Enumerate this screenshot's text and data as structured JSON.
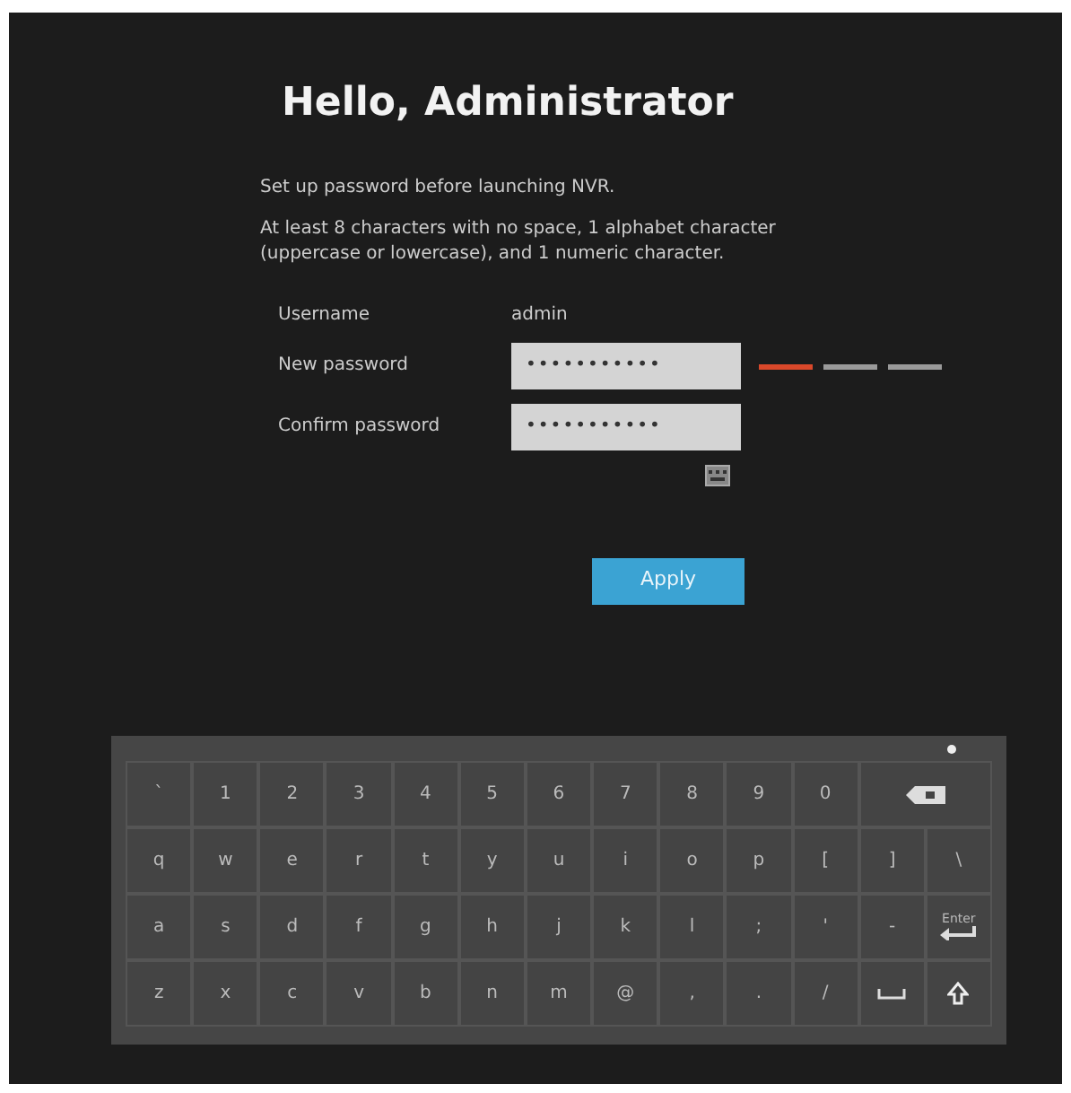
{
  "title": "Hello, Administrator",
  "intro": "Set up password before launching NVR.",
  "rules": "At least 8 characters with no space, 1 alphabet character (uppercase or lowercase), and 1 numeric character.",
  "form": {
    "username_label": "Username",
    "username": "admin",
    "new_label": "New password",
    "new_value": "•••••••••••",
    "confirm_label": "Confirm password",
    "confirm_value": "•••••••••••"
  },
  "strength": [
    {
      "color": "#d9482a"
    },
    {
      "color": "#9a9a9a"
    },
    {
      "color": "#9a9a9a"
    }
  ],
  "apply": "Apply",
  "keyboard": [
    [
      {
        "kind": "key",
        "label": "`"
      },
      {
        "kind": "key",
        "label": "1"
      },
      {
        "kind": "key",
        "label": "2"
      },
      {
        "kind": "key",
        "label": "3"
      },
      {
        "kind": "key",
        "label": "4"
      },
      {
        "kind": "key",
        "label": "5"
      },
      {
        "kind": "key",
        "label": "6"
      },
      {
        "kind": "key",
        "label": "7"
      },
      {
        "kind": "key",
        "label": "8"
      },
      {
        "kind": "key",
        "label": "9"
      },
      {
        "kind": "key",
        "label": "0"
      },
      {
        "kind": "backspace"
      }
    ],
    [
      {
        "kind": "key",
        "label": "q"
      },
      {
        "kind": "key",
        "label": "w"
      },
      {
        "kind": "key",
        "label": "e"
      },
      {
        "kind": "key",
        "label": "r"
      },
      {
        "kind": "key",
        "label": "t"
      },
      {
        "kind": "key",
        "label": "y"
      },
      {
        "kind": "key",
        "label": "u"
      },
      {
        "kind": "key",
        "label": "i"
      },
      {
        "kind": "key",
        "label": "o"
      },
      {
        "kind": "key",
        "label": "p"
      },
      {
        "kind": "key",
        "label": "["
      },
      {
        "kind": "key",
        "label": "]"
      },
      {
        "kind": "key",
        "label": "\\"
      }
    ],
    [
      {
        "kind": "key",
        "label": "a"
      },
      {
        "kind": "key",
        "label": "s"
      },
      {
        "kind": "key",
        "label": "d"
      },
      {
        "kind": "key",
        "label": "f"
      },
      {
        "kind": "key",
        "label": "g"
      },
      {
        "kind": "key",
        "label": "h"
      },
      {
        "kind": "key",
        "label": "j"
      },
      {
        "kind": "key",
        "label": "k"
      },
      {
        "kind": "key",
        "label": "l"
      },
      {
        "kind": "key",
        "label": ";"
      },
      {
        "kind": "key",
        "label": "'"
      },
      {
        "kind": "key",
        "label": "-"
      },
      {
        "kind": "enter",
        "label": "Enter"
      }
    ],
    [
      {
        "kind": "key",
        "label": "z"
      },
      {
        "kind": "key",
        "label": "x"
      },
      {
        "kind": "key",
        "label": "c"
      },
      {
        "kind": "key",
        "label": "v"
      },
      {
        "kind": "key",
        "label": "b"
      },
      {
        "kind": "key",
        "label": "n"
      },
      {
        "kind": "key",
        "label": "m"
      },
      {
        "kind": "key",
        "label": "@"
      },
      {
        "kind": "key",
        "label": ","
      },
      {
        "kind": "key",
        "label": "."
      },
      {
        "kind": "key",
        "label": "/"
      },
      {
        "kind": "space"
      },
      {
        "kind": "shift"
      }
    ]
  ]
}
